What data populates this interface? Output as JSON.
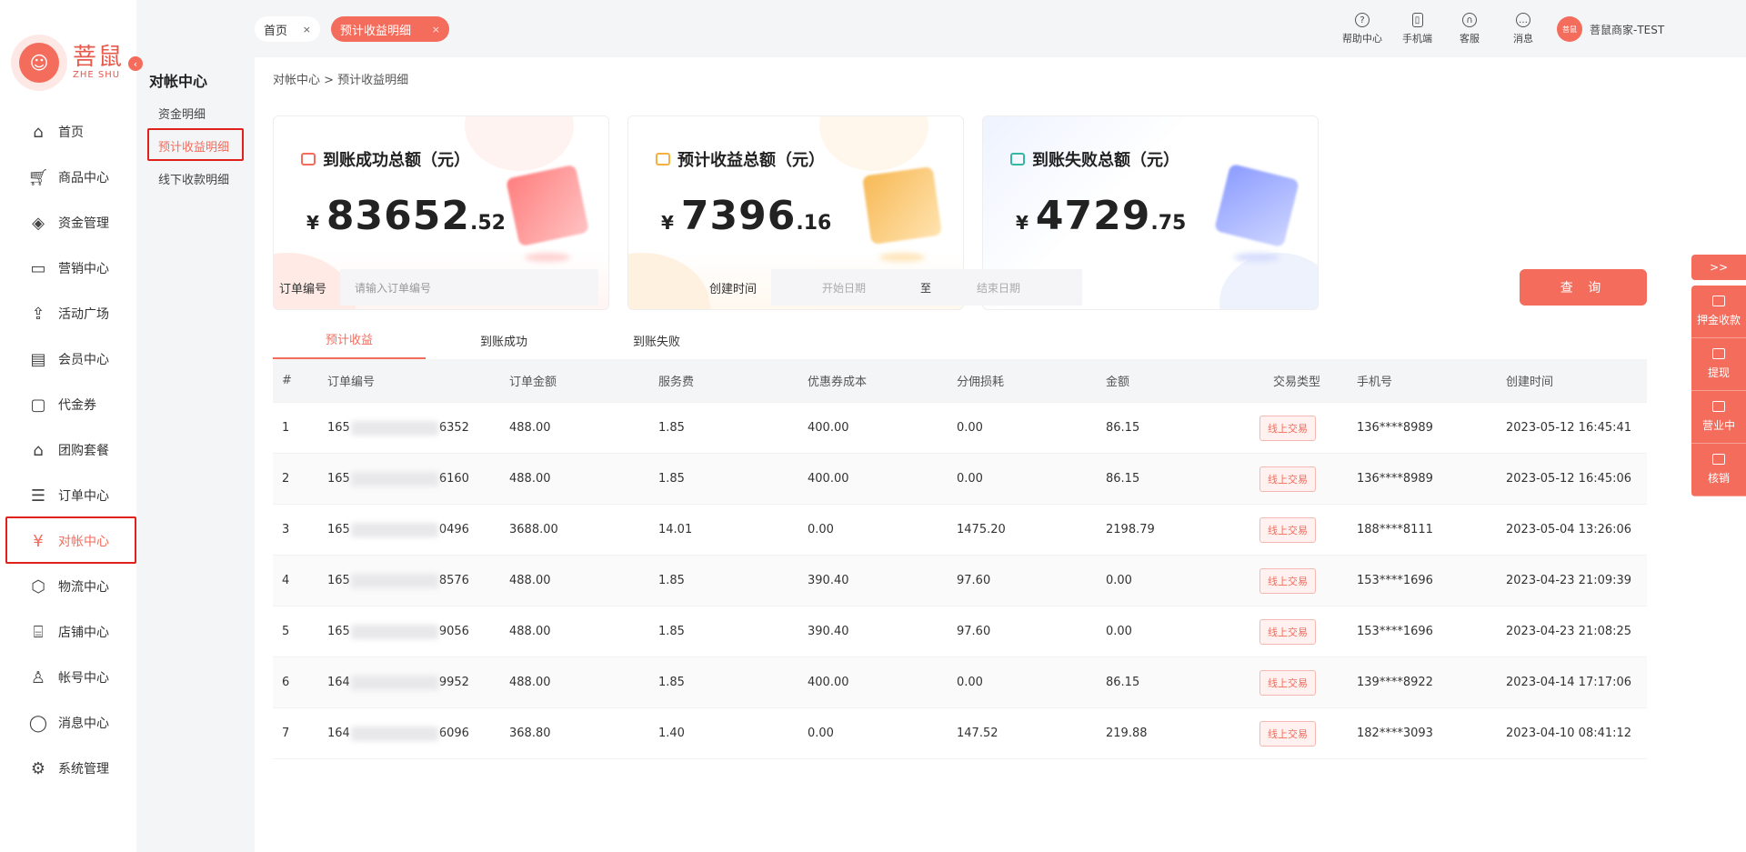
{
  "logo": {
    "main_text": "菩鼠",
    "sub_text": "ZHE SHU",
    "mascot_icon": "mouse-mascot-icon"
  },
  "nav": {
    "items": [
      {
        "label": "首页",
        "icon": "home-icon"
      },
      {
        "label": "商品中心",
        "icon": "cart-icon"
      },
      {
        "label": "资金管理",
        "icon": "layers-icon"
      },
      {
        "label": "营销中心",
        "icon": "megaphone-icon"
      },
      {
        "label": "活动广场",
        "icon": "box-up-icon"
      },
      {
        "label": "会员中心",
        "icon": "vip-card-icon"
      },
      {
        "label": "代金券",
        "icon": "coupon-icon"
      },
      {
        "label": "团购套餐",
        "icon": "bag-icon"
      },
      {
        "label": "订单中心",
        "icon": "order-icon"
      },
      {
        "label": "对帐中心",
        "icon": "yuan-icon"
      },
      {
        "label": "物流中心",
        "icon": "package-icon"
      },
      {
        "label": "店铺中心",
        "icon": "store-icon"
      },
      {
        "label": "帐号中心",
        "icon": "user-icon"
      },
      {
        "label": "消息中心",
        "icon": "message-icon"
      },
      {
        "label": "系统管理",
        "icon": "settings-icon"
      }
    ],
    "active_index": 9
  },
  "subnav": {
    "title": "对帐中心",
    "items": [
      {
        "label": "资金明细"
      },
      {
        "label": "预计收益明细"
      },
      {
        "label": "线下收款明细"
      }
    ],
    "active_index": 1
  },
  "topbar": {
    "tabs": [
      {
        "label": "首页",
        "close": "×"
      },
      {
        "label": "预计收益明细",
        "close": "×"
      }
    ],
    "tools": [
      {
        "label": "帮助中心",
        "icon": "help-icon",
        "glyph": "?"
      },
      {
        "label": "手机端",
        "icon": "phone-icon",
        "glyph": "▯"
      },
      {
        "label": "客服",
        "icon": "headset-icon",
        "glyph": "∩"
      },
      {
        "label": "消息",
        "icon": "chat-icon",
        "glyph": "…"
      }
    ],
    "user": {
      "name": "菩鼠商家-TEST",
      "avatar_text": "菩鼠"
    }
  },
  "breadcrumb": "对帐中心  > 预计收益明细",
  "cards": [
    {
      "title": "到账成功总额（元）",
      "currency": "¥",
      "integer": "83652",
      "decimal": ".52",
      "icon": "wallet-icon"
    },
    {
      "title": "预计收益总额（元）",
      "currency": "¥",
      "integer": "7396",
      "decimal": ".16",
      "icon": "coins-icon"
    },
    {
      "title": "到账失败总额（元）",
      "currency": "¥",
      "integer": "4729",
      "decimal": ".75",
      "icon": "failed-icon"
    }
  ],
  "filters": {
    "order_label": "订单编号",
    "order_placeholder": "请输入订单编号",
    "time_label": "创建时间",
    "start_placeholder": "开始日期",
    "range_sep": "至",
    "end_placeholder": "结束日期",
    "query_label": "查 询"
  },
  "tabs": [
    {
      "label": "预计收益"
    },
    {
      "label": "到账成功"
    },
    {
      "label": "到账失败"
    }
  ],
  "table": {
    "headers": [
      "#",
      "订单编号",
      "订单金额",
      "服务费",
      "优惠券成本",
      "分佣损耗",
      "金额",
      "交易类型",
      "手机号",
      "创建时间"
    ],
    "rows": [
      {
        "idx": "1",
        "order_prefix": "165",
        "order_suffix": "6352",
        "amount": "488.00",
        "fee": "1.85",
        "coupon": "400.00",
        "commission": "0.00",
        "net": "86.15",
        "type": "线上交易",
        "phone": "136****8989",
        "time": "2023-05-12 16:45:41"
      },
      {
        "idx": "2",
        "order_prefix": "165",
        "order_suffix": "6160",
        "amount": "488.00",
        "fee": "1.85",
        "coupon": "400.00",
        "commission": "0.00",
        "net": "86.15",
        "type": "线上交易",
        "phone": "136****8989",
        "time": "2023-05-12 16:45:06"
      },
      {
        "idx": "3",
        "order_prefix": "165",
        "order_suffix": "0496",
        "amount": "3688.00",
        "fee": "14.01",
        "coupon": "0.00",
        "commission": "1475.20",
        "net": "2198.79",
        "type": "线上交易",
        "phone": "188****8111",
        "time": "2023-05-04 13:26:06"
      },
      {
        "idx": "4",
        "order_prefix": "165",
        "order_suffix": "8576",
        "amount": "488.00",
        "fee": "1.85",
        "coupon": "390.40",
        "commission": "97.60",
        "net": "0.00",
        "type": "线上交易",
        "phone": "153****1696",
        "time": "2023-04-23 21:09:39"
      },
      {
        "idx": "5",
        "order_prefix": "165",
        "order_suffix": "9056",
        "amount": "488.00",
        "fee": "1.85",
        "coupon": "390.40",
        "commission": "97.60",
        "net": "0.00",
        "type": "线上交易",
        "phone": "153****1696",
        "time": "2023-04-23 21:08:25"
      },
      {
        "idx": "6",
        "order_prefix": "164",
        "order_suffix": "9952",
        "amount": "488.00",
        "fee": "1.85",
        "coupon": "400.00",
        "commission": "0.00",
        "net": "86.15",
        "type": "线上交易",
        "phone": "139****8922",
        "time": "2023-04-14 17:17:06"
      },
      {
        "idx": "7",
        "order_prefix": "164",
        "order_suffix": "6096",
        "amount": "368.80",
        "fee": "1.40",
        "coupon": "0.00",
        "commission": "147.52",
        "net": "219.88",
        "type": "线上交易",
        "phone": "182****3093",
        "time": "2023-04-10 08:41:12"
      }
    ]
  },
  "float_panel": {
    "expand_label": ">>",
    "items": [
      {
        "label": "押金收款",
        "icon": "deposit-icon"
      },
      {
        "label": "提现",
        "icon": "withdraw-icon"
      },
      {
        "label": "营业中",
        "icon": "open-store-icon"
      },
      {
        "label": "核销",
        "icon": "verify-icon"
      }
    ]
  },
  "colors": {
    "accent": "#f46c5c",
    "highlight_box": "#e0221c"
  }
}
